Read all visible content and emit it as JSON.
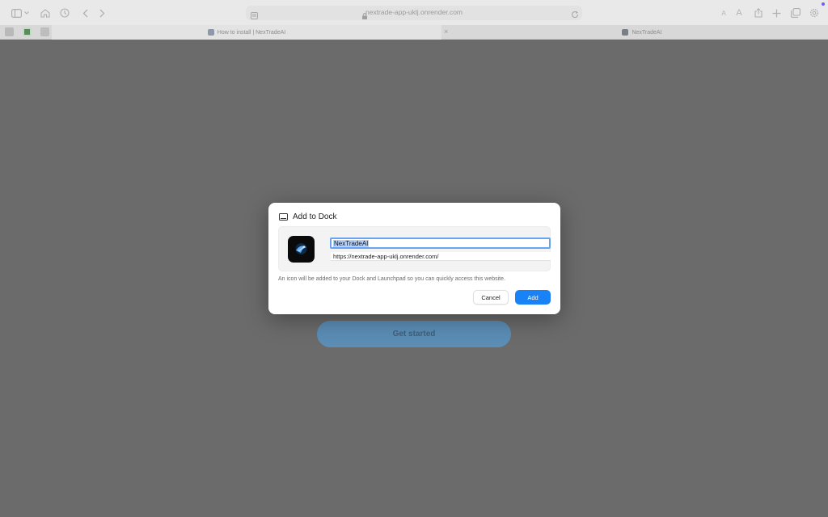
{
  "browser": {
    "address_text": "nextrade-app-uklj.onrender.com",
    "tabs": [
      {
        "label": "How to install | NexTradeAI"
      },
      {
        "label": "NexTradeAI"
      }
    ],
    "close_glyph": "×"
  },
  "page": {
    "cta_label": "Get started"
  },
  "dialog": {
    "title": "Add to Dock",
    "name_value": "NexTradeAI",
    "url_value": "https://nextrade-app-uklj.onrender.com/",
    "description": "An icon will be added to your Dock and Launchpad so you can quickly access this website.",
    "cancel_label": "Cancel",
    "add_label": "Add"
  },
  "colors": {
    "accent": "#1a82f7",
    "overlay": "#6b6b6b",
    "cta": "#5b8db5"
  },
  "icons": [
    "sidebar-icon",
    "chevron-down-icon",
    "home-icon",
    "history-icon",
    "back-icon",
    "forward-icon",
    "reader-icon",
    "lock-icon",
    "reload-icon",
    "text-size-icon",
    "share-icon",
    "new-tab-icon",
    "tabs-overview-icon",
    "settings-icon",
    "dock-icon"
  ]
}
